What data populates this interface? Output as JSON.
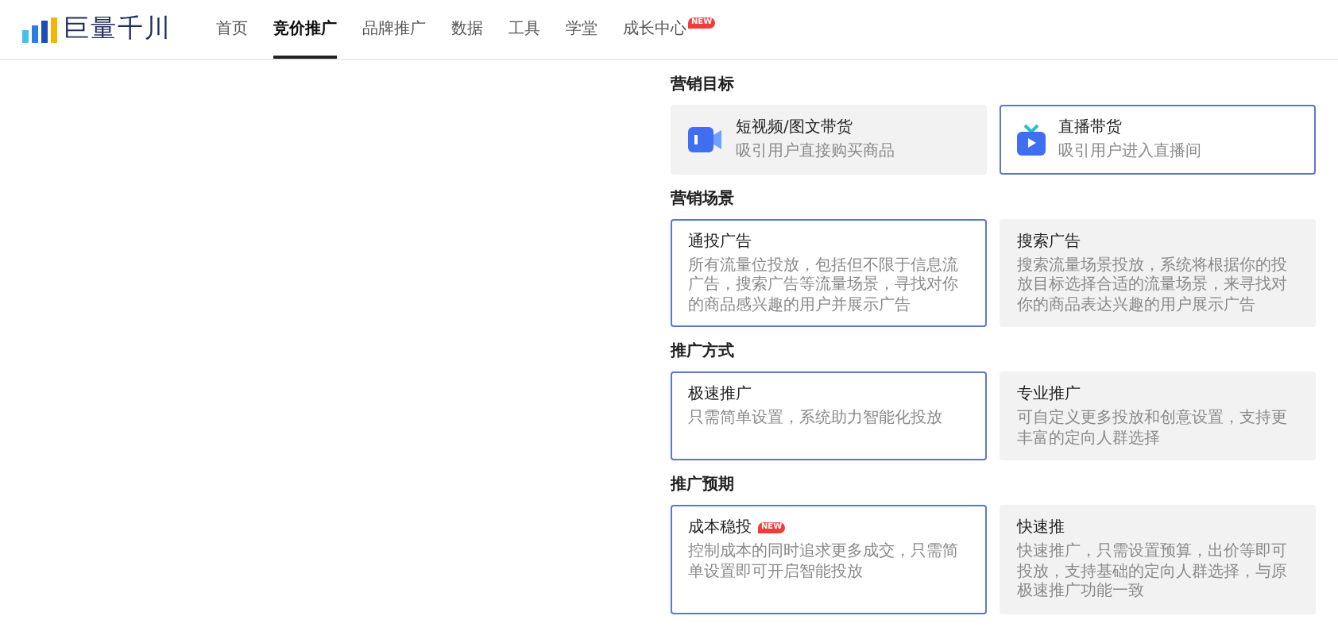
{
  "header": {
    "logo": "巨量千川",
    "nav": [
      {
        "label": "首页",
        "selected": false
      },
      {
        "label": "竞价推广",
        "selected": true
      },
      {
        "label": "品牌推广",
        "selected": false
      },
      {
        "label": "数据",
        "selected": false
      },
      {
        "label": "工具",
        "selected": false
      },
      {
        "label": "学堂",
        "selected": false
      },
      {
        "label": "成长中心",
        "selected": false,
        "badge": "NEW"
      }
    ]
  },
  "sections": [
    {
      "title": "营销目标",
      "options": [
        {
          "title": "短视频/图文带货",
          "description": "吸引用户直接购买商品",
          "kind": "video",
          "selected": false
        },
        {
          "title": "直播带货",
          "description": "吸引用户进入直播间",
          "kind": "tv",
          "selected": true
        }
      ]
    },
    {
      "title": "营销场景",
      "options": [
        {
          "title": "通投广告",
          "description": "所有流量位投放，包括但不限于信息流广告，搜索广告等流量场景，寻找对你的商品感兴趣的用户并展示广告",
          "selected": true
        },
        {
          "title": "搜索广告",
          "description": "搜索流量场景投放，系统将根据你的投放目标选择合适的流量场景，来寻找对你的商品表达兴趣的用户展示广告",
          "selected": false
        }
      ]
    },
    {
      "title": "推广方式",
      "options": [
        {
          "title": "极速推广",
          "description": "只需简单设置，系统助力智能化投放",
          "selected": true
        },
        {
          "title": "专业推广",
          "description": "可自定义更多投放和创意设置，支持更丰富的定向人群选择",
          "selected": false
        }
      ]
    },
    {
      "title": "推广预期",
      "options": [
        {
          "title": "成本稳投",
          "badge": "NEW",
          "description": "控制成本的同时追求更多成交，只需简单设置即可开启智能投放",
          "selected": true
        },
        {
          "title": "快速推",
          "description": "快速推广，只需设置预算，出价等即可投放，支持基础的定向人群选择，与原极速推广功能一致",
          "selected": false
        }
      ]
    }
  ]
}
